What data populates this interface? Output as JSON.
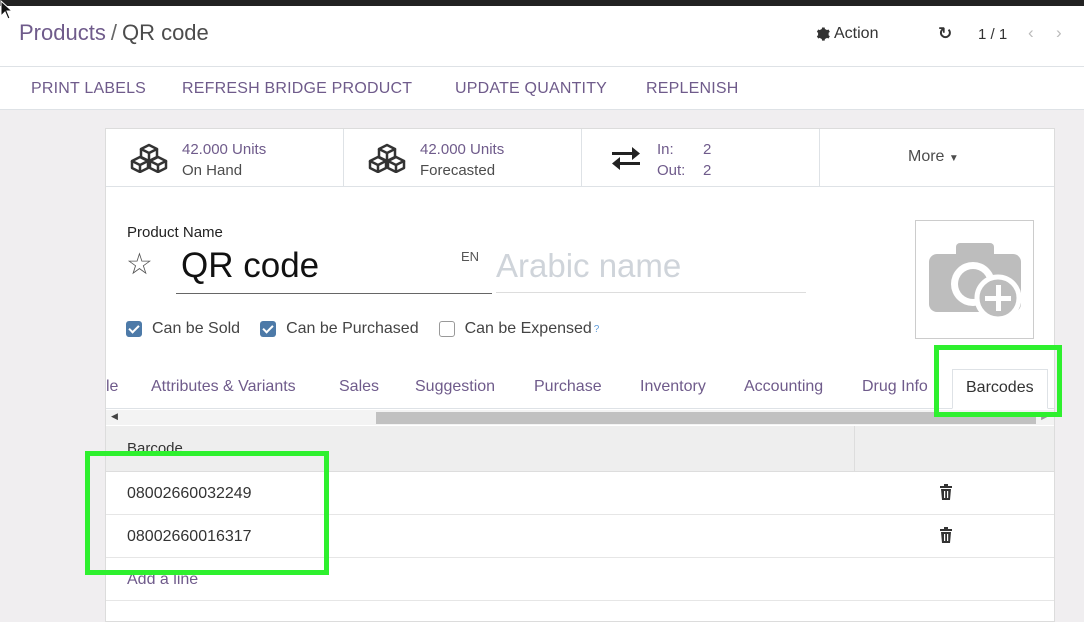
{
  "breadcrumb": {
    "parent": "Products",
    "separator": "/",
    "current": "QR code"
  },
  "toolbar": {
    "action_label": "Action",
    "pager_value": "1 / 1"
  },
  "header_buttons": [
    "PRINT LABELS",
    "REFRESH BRIDGE PRODUCT",
    "UPDATE QUANTITY",
    "REPLENISH"
  ],
  "stat_buttons": {
    "on_hand": {
      "value": "42.000 Units",
      "label": "On Hand"
    },
    "forecasted": {
      "value": "42.000 Units",
      "label": "Forecasted"
    },
    "moves": {
      "in_label": "In:",
      "in_value": "2",
      "out_label": "Out:",
      "out_value": "2"
    },
    "more_label": "More"
  },
  "form": {
    "name_label": "Product Name",
    "name_value": "QR code",
    "lang_code": "EN",
    "arabic_placeholder": "Arabic name",
    "checkboxes": [
      {
        "label": "Can be Sold",
        "checked": true
      },
      {
        "label": "Can be Purchased",
        "checked": true
      },
      {
        "label": "Can be Expensed",
        "checked": false,
        "help": "?"
      }
    ]
  },
  "tabs": [
    "le",
    "Attributes & Variants",
    "Sales",
    "Suggestion",
    "Purchase",
    "Inventory",
    "Accounting",
    "Drug Info",
    "Barcodes"
  ],
  "active_tab": "Barcodes",
  "barcodes_table": {
    "header": "Barcode",
    "rows": [
      "08002660032249",
      "08002660016317"
    ],
    "add_line_label": "Add a line"
  },
  "colors": {
    "link": "#6f5b8b",
    "highlight": "#2ef02e",
    "checkbox": "#4d7aa8"
  }
}
